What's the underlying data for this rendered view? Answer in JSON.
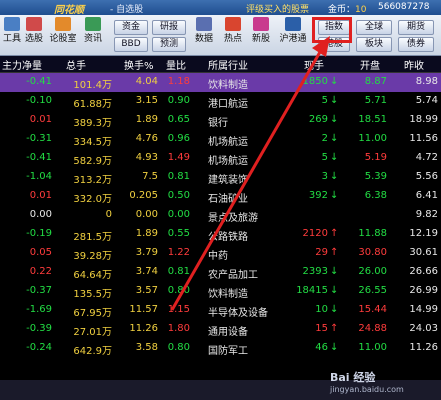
{
  "titlebar": {
    "app_logo": "同花顺",
    "window_title": "- 自选股",
    "promo": "评级买入的股票",
    "coins_label": "金币：",
    "coins_value": "10",
    "user_id": "566087278"
  },
  "toolbar": {
    "left_tools": [
      {
        "label": "工具",
        "icon": "tools-icon"
      },
      {
        "label": "选股",
        "icon": "stock-picker-icon"
      },
      {
        "label": "论股室",
        "icon": "discussion-icon"
      },
      {
        "label": "资讯",
        "icon": "news-icon"
      }
    ],
    "mid_buttons": [
      "资金",
      "研报",
      "BBD",
      "预测"
    ],
    "right_tools": [
      {
        "label": "数据",
        "icon": "data-icon"
      },
      {
        "label": "热点",
        "icon": "hotspot-icon"
      },
      {
        "label": "新股",
        "icon": "new-stock-icon"
      },
      {
        "label": "沪港通",
        "icon": "hk-connect-icon"
      }
    ],
    "index_button": "指数",
    "global_button": "全球",
    "futures_button": "期货",
    "hk_button": "港股",
    "board_button": "板块",
    "bond_button": "债券"
  },
  "table": {
    "headers": [
      "主力净量",
      "总手",
      "换手%",
      "量比",
      "所属行业",
      "现手",
      "开盘",
      "昨收"
    ],
    "rows": [
      {
        "net": "-0.41",
        "vol": "101.4万",
        "turn": "4.04",
        "ratio": "1.18",
        "ind": "饮料制造",
        "cur": "1850",
        "dir": "down",
        "open": "8.87",
        "prev": "8.98",
        "sel": true
      },
      {
        "net": "-0.10",
        "vol": "61.88万",
        "turn": "3.15",
        "ratio": "0.90",
        "ind": "港口航运",
        "cur": "5",
        "dir": "down",
        "open": "5.71",
        "prev": "5.74"
      },
      {
        "net": "0.01",
        "vol": "389.3万",
        "turn": "1.89",
        "ratio": "0.65",
        "ind": "银行",
        "cur": "269",
        "dir": "down",
        "open": "18.51",
        "prev": "18.99"
      },
      {
        "net": "-0.31",
        "vol": "334.5万",
        "turn": "4.76",
        "ratio": "0.96",
        "ind": "机场航运",
        "cur": "2",
        "dir": "down",
        "open": "11.00",
        "prev": "11.56"
      },
      {
        "net": "-0.41",
        "vol": "582.9万",
        "turn": "4.93",
        "ratio": "1.49",
        "ind": "机场航运",
        "cur": "5",
        "dir": "down",
        "open": "5.19",
        "prev": "4.72"
      },
      {
        "net": "-1.04",
        "vol": "313.2万",
        "turn": "7.5",
        "ratio": "0.81",
        "ind": "建筑装饰",
        "cur": "3",
        "dir": "down",
        "open": "5.39",
        "prev": "5.56"
      },
      {
        "net": "0.01",
        "vol": "332.0万",
        "turn": "0.205",
        "ratio": "0.50",
        "ind": "石油矿业",
        "cur": "392",
        "dir": "down",
        "open": "6.38",
        "prev": "6.41"
      },
      {
        "net": "0.00",
        "vol": "0",
        "turn": "0.00",
        "ratio": "0.00",
        "ind": "景点及旅游",
        "cur": "",
        "dir": "",
        "open": "",
        "prev": "9.82"
      },
      {
        "net": "-0.19",
        "vol": "281.5万",
        "turn": "1.89",
        "ratio": "0.55",
        "ind": "公路铁路",
        "cur": "2120",
        "dir": "up",
        "open": "11.88",
        "prev": "12.19"
      },
      {
        "net": "0.05",
        "vol": "39.28万",
        "turn": "3.79",
        "ratio": "1.22",
        "ind": "中药",
        "cur": "29",
        "dir": "up",
        "open": "30.80",
        "prev": "30.61"
      },
      {
        "net": "0.22",
        "vol": "64.64万",
        "turn": "3.74",
        "ratio": "0.81",
        "ind": "农产品加工",
        "cur": "2393",
        "dir": "down",
        "open": "26.00",
        "prev": "26.66"
      },
      {
        "net": "-0.37",
        "vol": "135.5万",
        "turn": "3.57",
        "ratio": "0.80",
        "ind": "饮料制造",
        "cur": "18415",
        "dir": "down",
        "open": "26.55",
        "prev": "26.99"
      },
      {
        "net": "-1.69",
        "vol": "67.95万",
        "turn": "11.57",
        "ratio": "1.15",
        "ind": "半导体及设备",
        "cur": "10",
        "dir": "down",
        "open": "15.44",
        "prev": "14.99"
      },
      {
        "net": "-0.39",
        "vol": "27.01万",
        "turn": "11.26",
        "ratio": "1.80",
        "ind": "通用设备",
        "cur": "15",
        "dir": "up",
        "open": "24.88",
        "prev": "24.03"
      },
      {
        "net": "-0.24",
        "vol": "642.9万",
        "turn": "3.58",
        "ratio": "0.80",
        "ind": "国防军工",
        "cur": "46",
        "dir": "down",
        "open": "11.00",
        "prev": "11.26"
      }
    ]
  },
  "watermark": {
    "brand": "Bai 经验",
    "url": "jingyan.baidu.com"
  },
  "colors": {
    "up": "#ff3c3c",
    "down": "#22dd44",
    "selected_row": "#6a3aa8",
    "annotation": "#e02020"
  }
}
